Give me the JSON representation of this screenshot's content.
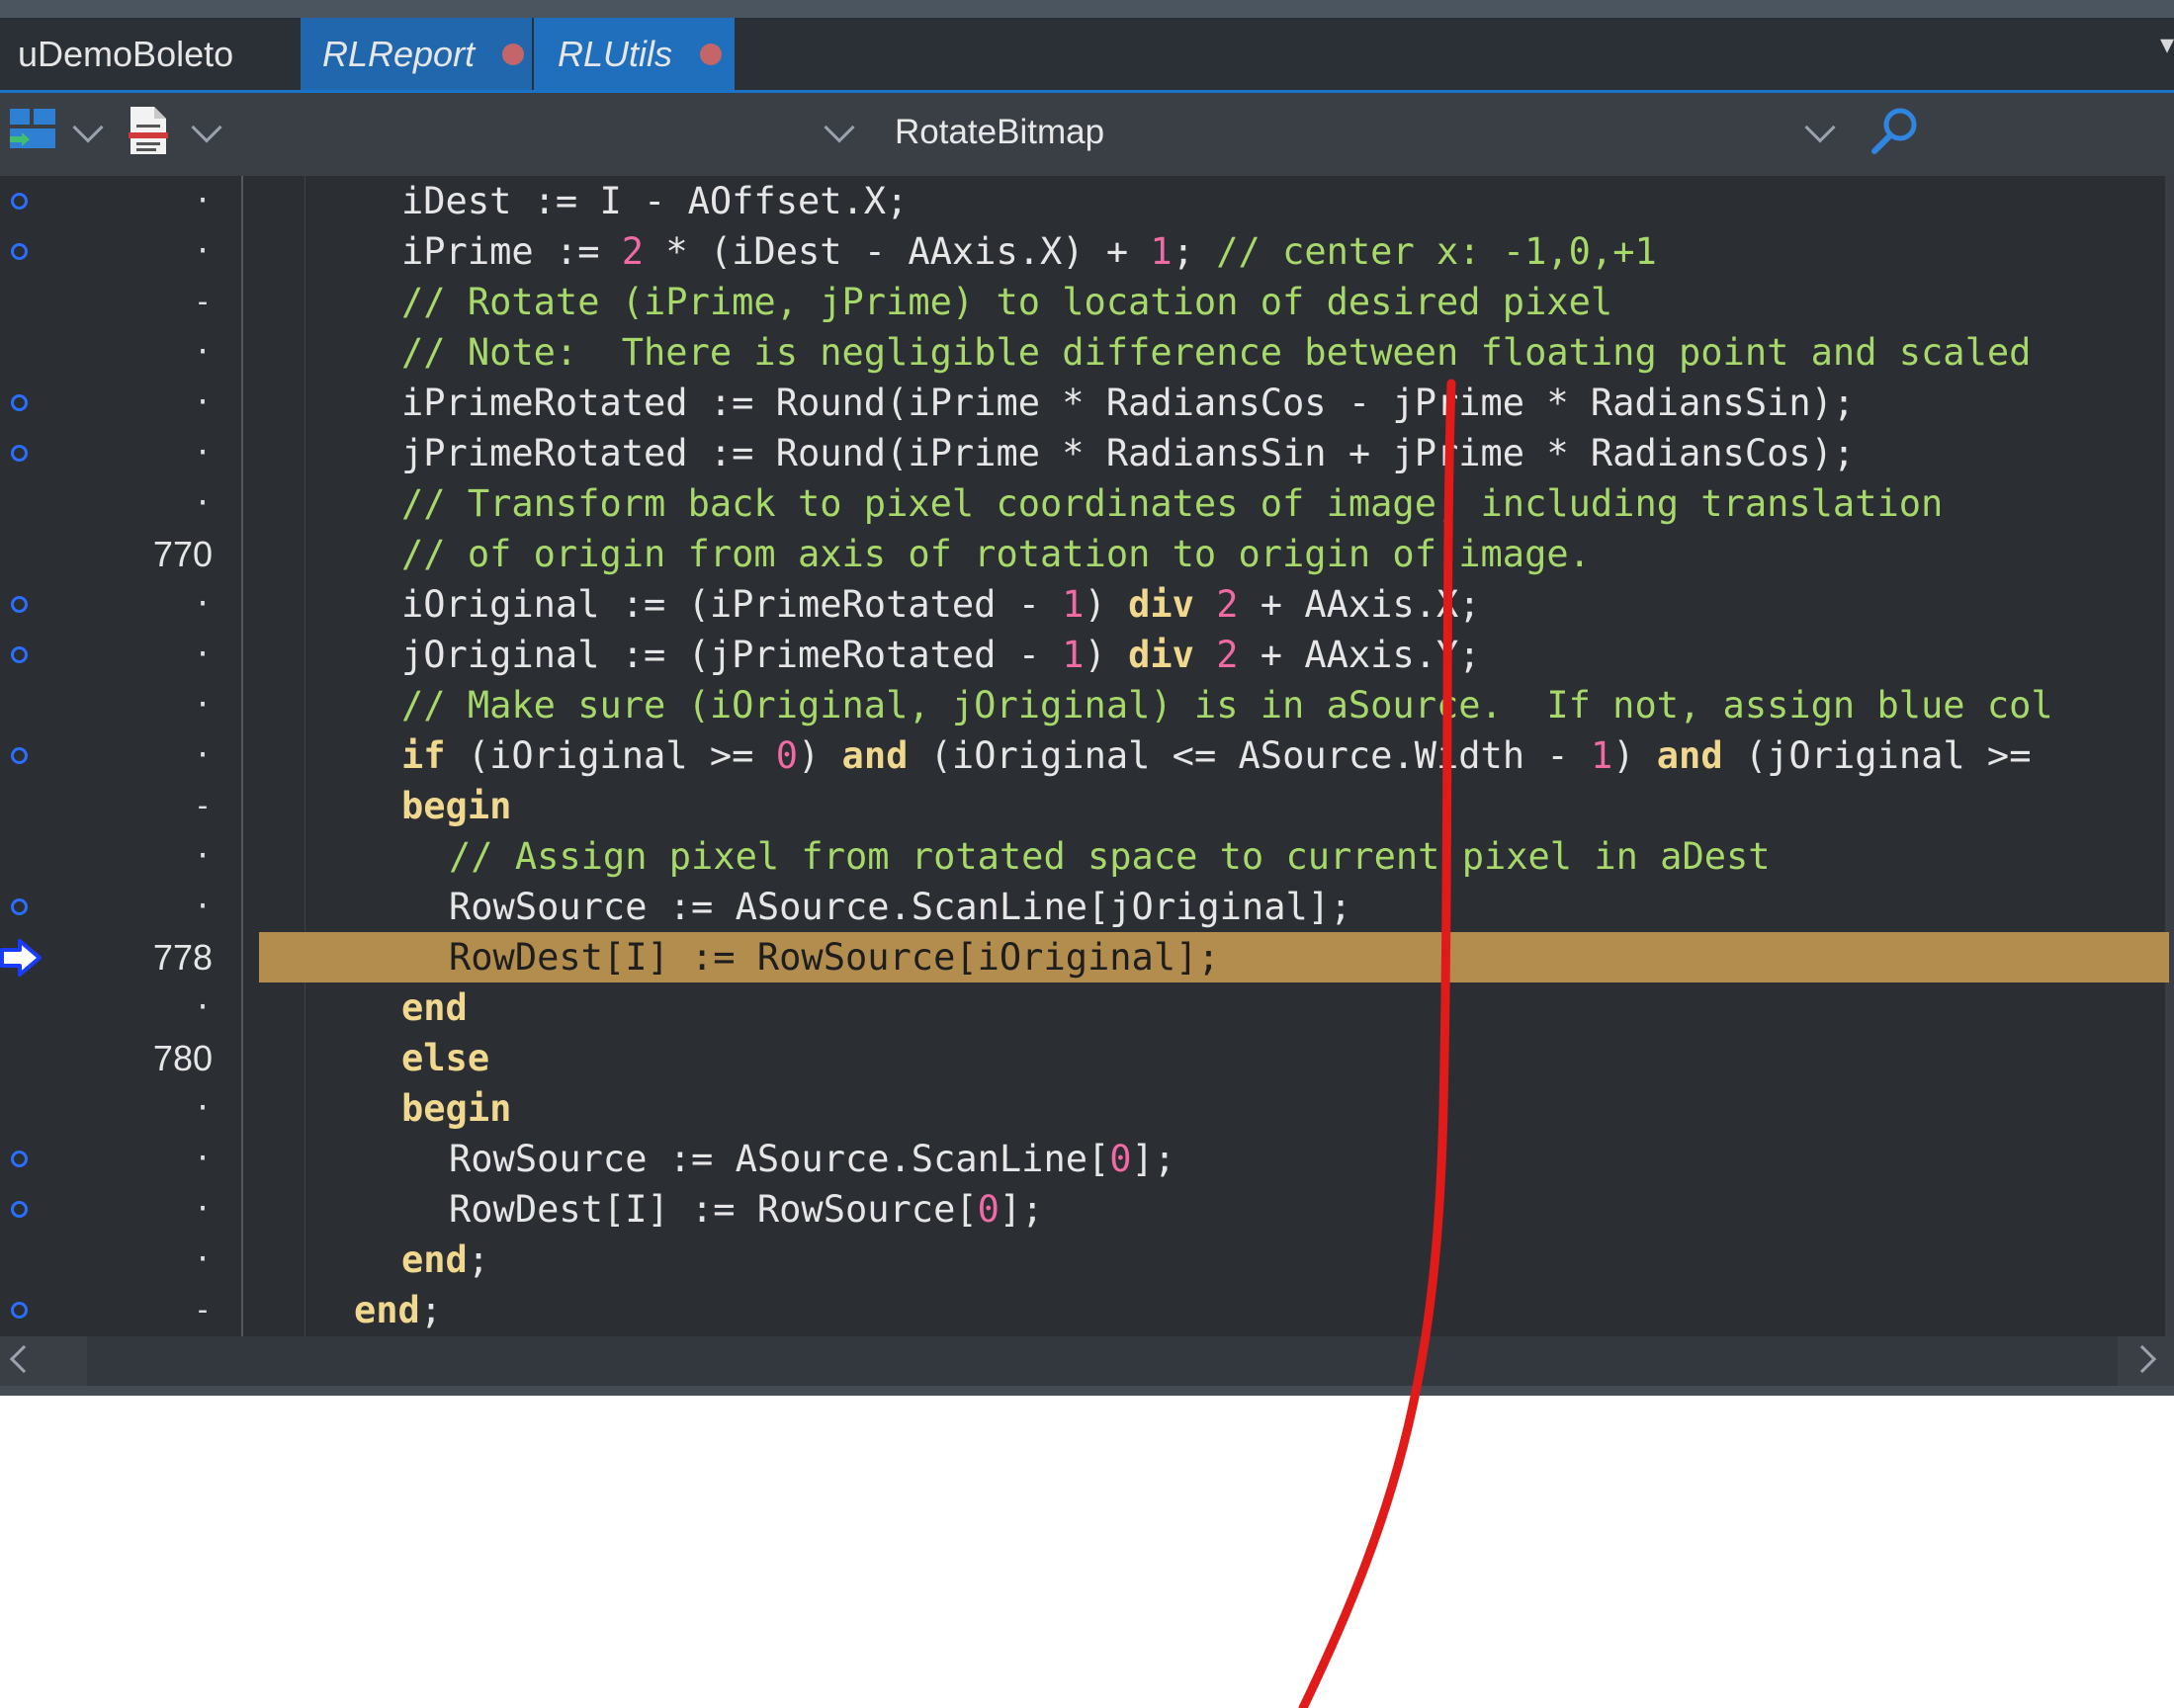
{
  "tabs": [
    {
      "label": "uDemoBoleto",
      "modified": false
    },
    {
      "label": "RLReport",
      "modified": true
    },
    {
      "label": "RLUtils",
      "modified": true
    }
  ],
  "toolbar": {
    "method": "RotateBitmap",
    "icons": [
      "layout-icon",
      "document-icon",
      "search-icon"
    ]
  },
  "colors": {
    "keyword": "#f1d88f",
    "number": "#f06aa3",
    "comment": "#a7d96a",
    "execution_line": "#b28d4d",
    "breakpoint": "#2a6fff",
    "annotation": "#e11a1a"
  },
  "lines": [
    {
      "num": "",
      "marker": "·",
      "bp": true,
      "exec": false,
      "indent": 0,
      "tokens": [
        [
          "id",
          "iDest := I - AOffset.X;"
        ]
      ]
    },
    {
      "num": "",
      "marker": "·",
      "bp": true,
      "exec": false,
      "indent": 0,
      "tokens": [
        [
          "id",
          "iPrime := "
        ],
        [
          "num",
          "2"
        ],
        [
          "id",
          " * (iDest - AAxis.X) + "
        ],
        [
          "num",
          "1"
        ],
        [
          "id",
          "; "
        ],
        [
          "cm",
          "// center x: -1,0,+1"
        ]
      ]
    },
    {
      "num": "",
      "marker": "-",
      "bp": false,
      "exec": false,
      "indent": 0,
      "tokens": [
        [
          "cm",
          "// Rotate (iPrime, jPrime) to location of desired pixel"
        ]
      ]
    },
    {
      "num": "",
      "marker": "·",
      "bp": false,
      "exec": false,
      "indent": 0,
      "tokens": [
        [
          "cm",
          "// Note:  There is negligible difference between floating point and scaled"
        ]
      ]
    },
    {
      "num": "",
      "marker": "·",
      "bp": true,
      "exec": false,
      "indent": 0,
      "tokens": [
        [
          "id",
          "iPrimeRotated := Round(iPrime * RadiansCos - jPrime * RadiansSin);"
        ]
      ]
    },
    {
      "num": "",
      "marker": "·",
      "bp": true,
      "exec": false,
      "indent": 0,
      "tokens": [
        [
          "id",
          "jPrimeRotated := Round(iPrime * RadiansSin + jPrime * RadiansCos);"
        ]
      ]
    },
    {
      "num": "",
      "marker": "·",
      "bp": false,
      "exec": false,
      "indent": 0,
      "tokens": [
        [
          "cm",
          "// Transform back to pixel coordinates of image, including translation"
        ]
      ]
    },
    {
      "num": "770",
      "marker": "",
      "bp": false,
      "exec": false,
      "indent": 0,
      "tokens": [
        [
          "cm",
          "// of origin from axis of rotation to origin of image."
        ]
      ]
    },
    {
      "num": "",
      "marker": "·",
      "bp": true,
      "exec": false,
      "indent": 0,
      "tokens": [
        [
          "id",
          "iOriginal := (iPrimeRotated - "
        ],
        [
          "num",
          "1"
        ],
        [
          "id",
          ") "
        ],
        [
          "kw",
          "div"
        ],
        [
          "id",
          " "
        ],
        [
          "num",
          "2"
        ],
        [
          "id",
          " + AAxis.X;"
        ]
      ]
    },
    {
      "num": "",
      "marker": "·",
      "bp": true,
      "exec": false,
      "indent": 0,
      "tokens": [
        [
          "id",
          "jOriginal := (jPrimeRotated - "
        ],
        [
          "num",
          "1"
        ],
        [
          "id",
          ") "
        ],
        [
          "kw",
          "div"
        ],
        [
          "id",
          " "
        ],
        [
          "num",
          "2"
        ],
        [
          "id",
          " + AAxis.Y;"
        ]
      ]
    },
    {
      "num": "",
      "marker": "·",
      "bp": false,
      "exec": false,
      "indent": 0,
      "tokens": [
        [
          "cm",
          "// Make sure (iOriginal, jOriginal) is in aSource.  If not, assign blue col"
        ]
      ]
    },
    {
      "num": "",
      "marker": "·",
      "bp": true,
      "exec": false,
      "indent": 0,
      "tokens": [
        [
          "kw",
          "if"
        ],
        [
          "id",
          " (iOriginal >= "
        ],
        [
          "num",
          "0"
        ],
        [
          "id",
          ") "
        ],
        [
          "kw",
          "and"
        ],
        [
          "id",
          " (iOriginal <= ASource.Width - "
        ],
        [
          "num",
          "1"
        ],
        [
          "id",
          ") "
        ],
        [
          "kw",
          "and"
        ],
        [
          "id",
          " (jOriginal >="
        ]
      ]
    },
    {
      "num": "",
      "marker": "-",
      "bp": false,
      "exec": false,
      "indent": 0,
      "tokens": [
        [
          "kw",
          "begin"
        ]
      ]
    },
    {
      "num": "",
      "marker": "·",
      "bp": false,
      "exec": false,
      "indent": 1,
      "tokens": [
        [
          "cm",
          "// Assign pixel from rotated space to current pixel in aDest"
        ]
      ]
    },
    {
      "num": "",
      "marker": "·",
      "bp": true,
      "exec": false,
      "indent": 1,
      "tokens": [
        [
          "id",
          "RowSource := ASource.ScanLine[jOriginal];"
        ]
      ]
    },
    {
      "num": "778",
      "marker": "",
      "bp": false,
      "exec": true,
      "indent": 1,
      "tokens": [
        [
          "id",
          "RowDest[I] := RowSource[iOriginal];"
        ]
      ]
    },
    {
      "num": "",
      "marker": "·",
      "bp": false,
      "exec": false,
      "indent": 0,
      "tokens": [
        [
          "kw",
          "end"
        ]
      ]
    },
    {
      "num": "780",
      "marker": "",
      "bp": false,
      "exec": false,
      "indent": 0,
      "tokens": [
        [
          "kw",
          "else"
        ]
      ]
    },
    {
      "num": "",
      "marker": "·",
      "bp": false,
      "exec": false,
      "indent": 0,
      "tokens": [
        [
          "kw",
          "begin"
        ]
      ]
    },
    {
      "num": "",
      "marker": "·",
      "bp": true,
      "exec": false,
      "indent": 1,
      "tokens": [
        [
          "id",
          "RowSource := ASource.ScanLine["
        ],
        [
          "num",
          "0"
        ],
        [
          "id",
          "];"
        ]
      ]
    },
    {
      "num": "",
      "marker": "·",
      "bp": true,
      "exec": false,
      "indent": 1,
      "tokens": [
        [
          "id",
          "RowDest[I] := RowSource["
        ],
        [
          "num",
          "0"
        ],
        [
          "id",
          "];"
        ]
      ]
    },
    {
      "num": "",
      "marker": "·",
      "bp": false,
      "exec": false,
      "indent": 0,
      "tokens": [
        [
          "kw",
          "end"
        ],
        [
          "id",
          ";"
        ]
      ]
    },
    {
      "num": "",
      "marker": "-",
      "bp": true,
      "exec": false,
      "indent": -1,
      "tokens": [
        [
          "kw",
          "end"
        ],
        [
          "id",
          ";"
        ]
      ]
    }
  ]
}
